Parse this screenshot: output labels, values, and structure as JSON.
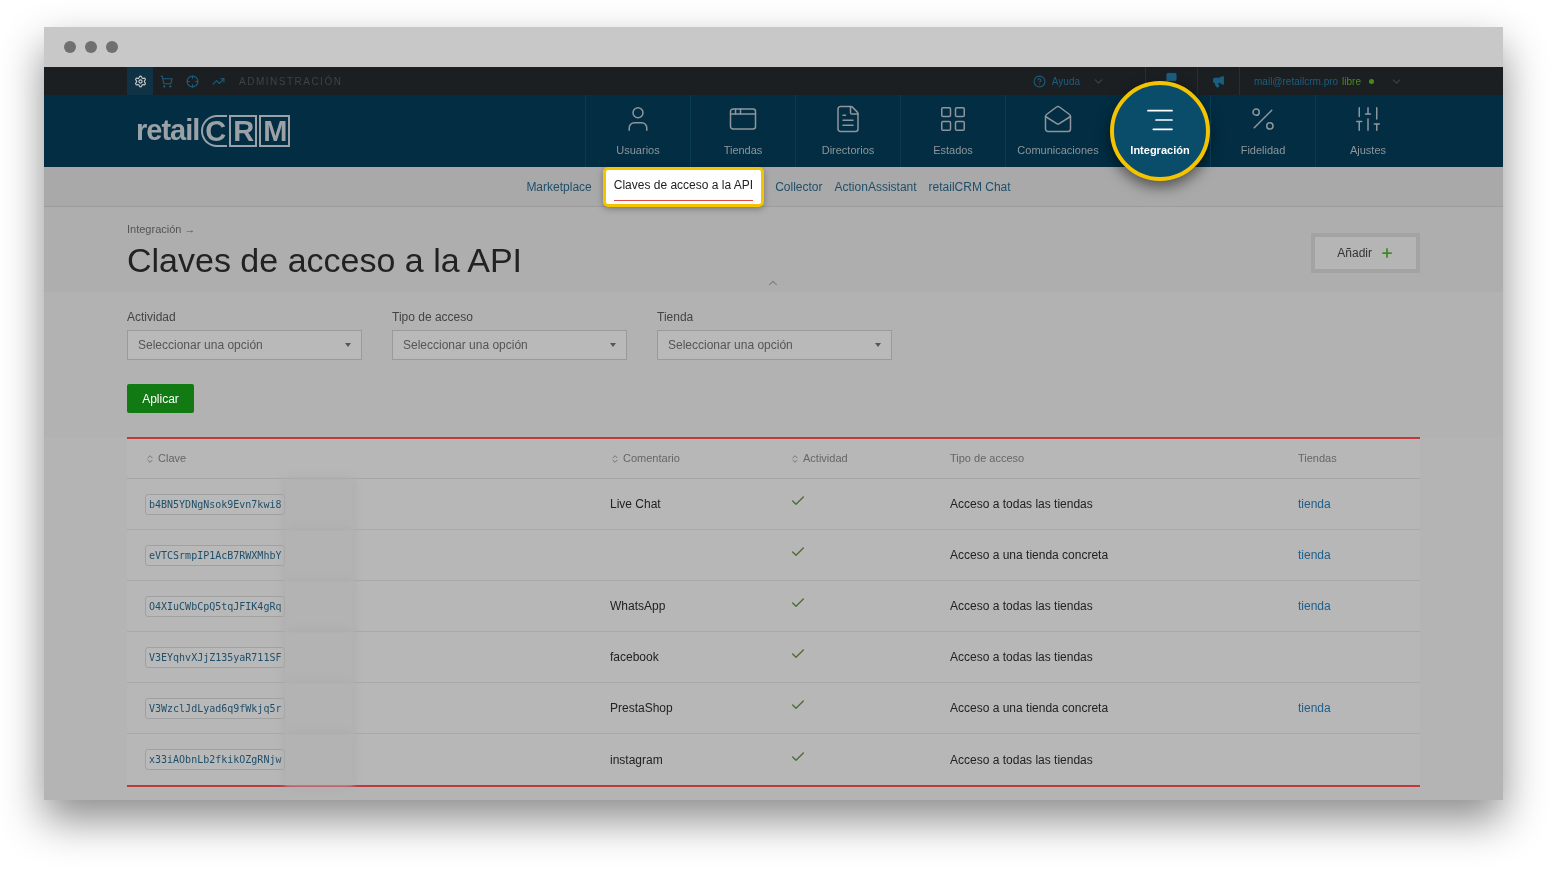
{
  "topbar": {
    "icons": [
      {
        "selected": true
      },
      {
        "selected": false
      },
      {
        "selected": false
      },
      {
        "selected": false
      }
    ],
    "section": "ADMINSTRACIÓN",
    "help": "Ayuda",
    "account": "mail@retailcrm.pro",
    "plan": "libre",
    "online": true
  },
  "logo": {
    "prefix": "retail",
    "letters": [
      "C",
      "R",
      "M"
    ]
  },
  "nav": [
    {
      "label": "Usuarios",
      "selected": false
    },
    {
      "label": "Tiendas",
      "selected": false
    },
    {
      "label": "Directorios",
      "selected": false
    },
    {
      "label": "Estados",
      "selected": false
    },
    {
      "label": "Comunicaciones",
      "selected": false
    },
    {
      "label": "Integración",
      "selected": true
    },
    {
      "label": "Fidelidad",
      "selected": false
    },
    {
      "label": "Ajustes",
      "selected": false
    }
  ],
  "subnav": [
    {
      "label": "Marketplace",
      "selected": false
    },
    {
      "label": "Claves de acceso a la API",
      "selected": true
    },
    {
      "label": "Collector",
      "selected": false
    },
    {
      "label": "ActionAssistant",
      "selected": false
    },
    {
      "label": "retailCRM Chat",
      "selected": false
    }
  ],
  "breadcrumb": "Integración →",
  "title": "Claves de acceso a la API",
  "add_button": "Añadir",
  "filters": [
    {
      "label": "Actividad",
      "placeholder": "Seleccionar una opción"
    },
    {
      "label": "Tipo de acceso",
      "placeholder": "Seleccionar una opción"
    },
    {
      "label": "Tienda",
      "placeholder": "Seleccionar una opción"
    }
  ],
  "apply_button": "Aplicar",
  "table": {
    "columns": [
      {
        "label": "Clave",
        "sortable": true
      },
      {
        "label": "Comentario",
        "sortable": true
      },
      {
        "label": "Actividad",
        "sortable": true
      },
      {
        "label": "Tipo de acceso",
        "sortable": false
      },
      {
        "label": "Tiendas",
        "sortable": false
      }
    ],
    "rows": [
      {
        "key": "b4BN5YDNgNsok9Evn7kwi8",
        "comment": "Live Chat",
        "active": true,
        "access": "Acceso a todas las tiendas",
        "stores": "tienda"
      },
      {
        "key": "eVTCSrmpIP1AcB7RWXMhbY",
        "comment": "",
        "active": true,
        "access": "Acceso a una tienda concreta",
        "stores": "tienda"
      },
      {
        "key": "O4XIuCWbCpQ5tqJFIK4gRq",
        "comment": "WhatsApp",
        "active": true,
        "access": "Acceso a todas las tiendas",
        "stores": "tienda"
      },
      {
        "key": "V3EYqhvXJjZ135yaR711SF",
        "comment": "facebook",
        "active": true,
        "access": "Acceso a todas las tiendas",
        "stores": ""
      },
      {
        "key": "V3WzclJdLyad6q9fWkjq5r",
        "comment": "PrestaShop",
        "active": true,
        "access": "Acceso a una tienda concreta",
        "stores": "tienda"
      },
      {
        "key": "x33iAObnLb2fkikOZgRNjw",
        "comment": "instagram",
        "active": true,
        "access": "Acceso a todas las tiendas",
        "stores": ""
      }
    ]
  }
}
